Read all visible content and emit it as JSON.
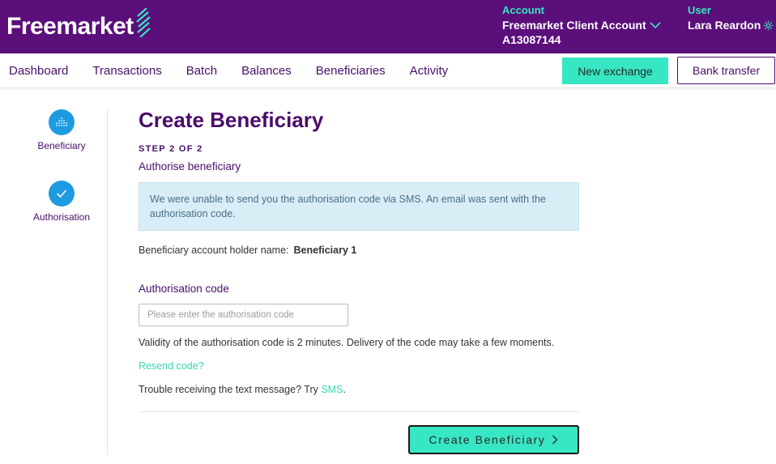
{
  "header": {
    "logo_text": "Freemarket",
    "account_label": "Account",
    "account_name": "Freemarket Client Account",
    "account_number": "A13087144",
    "user_label": "User",
    "user_name": "Lara Reardon"
  },
  "nav": {
    "items": [
      "Dashboard",
      "Transactions",
      "Batch",
      "Balances",
      "Beneficiaries",
      "Activity"
    ],
    "new_exchange": "New exchange",
    "bank_transfer": "Bank transfer"
  },
  "stepper": {
    "steps": [
      {
        "label": "Beneficiary",
        "icon": "dots-grid-icon"
      },
      {
        "label": "Authorisation",
        "icon": "check-icon"
      }
    ]
  },
  "form": {
    "title": "Create Beneficiary",
    "step_count": "STEP 2 OF 2",
    "subtitle": "Authorise beneficiary",
    "alert": "We were unable to send you the authorisation code via SMS. An email was sent with the authorisation code.",
    "holder_label": "Beneficiary account holder name:",
    "holder_name": "Beneficiary 1",
    "code_label": "Authorisation code",
    "code_placeholder": "Please enter the authorisation code",
    "code_value": "",
    "validity": "Validity of the authorisation code is 2 minutes. Delivery of the code may take a few moments.",
    "resend": "Resend code?",
    "trouble_text": "Trouble receiving the text message? Try ",
    "sms_link": "SMS",
    "trouble_end": ".",
    "submit": "Create Beneficiary"
  },
  "colors": {
    "brand_purple": "#5b0f7a",
    "accent_teal": "#37e6c3",
    "step_blue": "#1e9be0",
    "alert_bg": "#d9edf7"
  }
}
